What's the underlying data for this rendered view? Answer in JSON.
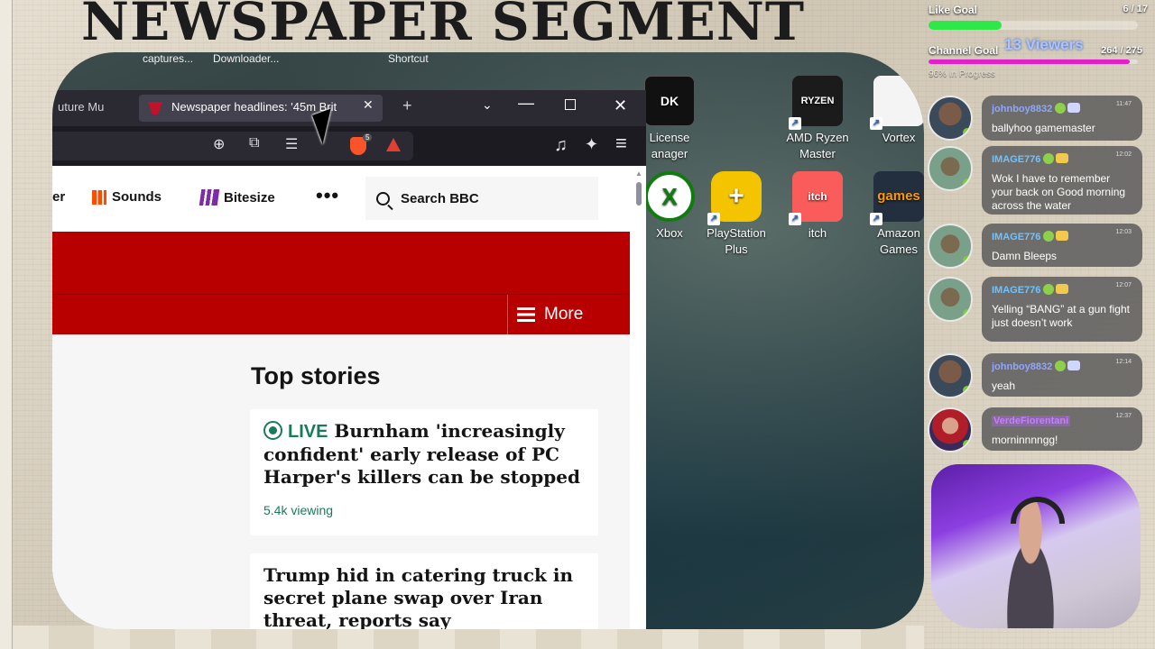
{
  "overlay": {
    "segment_title": "NEWSPAPER SEGMENT"
  },
  "desktop": {
    "top_labels": [
      "captures...",
      "Downloader...",
      "Shortcut"
    ],
    "icons": [
      {
        "label_line1": "License",
        "label_line2": "anager",
        "glyph": "DK",
        "color": "#111111"
      },
      {
        "label_line1": "AMD Ryzen",
        "label_line2": "Master",
        "glyph": "RYZEN",
        "color": "#1b1b1b"
      },
      {
        "label_line1": "Vortex",
        "label_line2": "",
        "glyph": "",
        "color": "#f4f4f4"
      },
      {
        "label_line1": "Xbox",
        "label_line2": "",
        "glyph": "X",
        "color": "#107c10"
      },
      {
        "label_line1": "PlayStation",
        "label_line2": "Plus",
        "glyph": "+",
        "color": "#f5c400"
      },
      {
        "label_line1": "itch",
        "label_line2": "",
        "glyph": "itch",
        "color": "#fa5c5c"
      },
      {
        "label_line1": "Amazon",
        "label_line2": "Games",
        "glyph": "games",
        "color": "#232f3e"
      }
    ]
  },
  "browser": {
    "prev_tab_label": "uture Mu",
    "active_tab_label": "Newspaper headlines: '45m Brit",
    "tab_close": "✕",
    "new_tab": "+",
    "tab_list": "⌄",
    "minimize": "—",
    "close": "✕",
    "toolbar": {
      "zoom": "⊕",
      "cast": "⧉",
      "reader": "☰",
      "extensions_badge": "5",
      "music": "♫",
      "sparkle": "✦",
      "menu": "≡"
    }
  },
  "bbc": {
    "nav_cut_label": "er",
    "sounds_label": "Sounds",
    "bitesize_label": "Bitesize",
    "more_dots": "•••",
    "search_label": "Search BBC",
    "more_button": "More",
    "section_title": "Top stories",
    "stories": [
      {
        "live_label": "LIVE",
        "headline": "Burnham 'increasingly confident' early release of PC Harper's killers can be stopped",
        "viewing": "5.4k viewing"
      },
      {
        "headline": "Trump hid in catering truck in secret plane swap over Iran threat, reports say"
      }
    ]
  },
  "goals": {
    "like_goal_label": "Like Goal",
    "like_goal_count": "6 / 17",
    "like_goal_fraction": 0.35,
    "like_color": "#2ee84a",
    "channel_goal_label": "Channel Goal",
    "viewers": "13 Viewers",
    "channel_goal_count": "264 / 275",
    "channel_goal_fraction": 0.96,
    "channel_color": "#e21fc8",
    "progress_note": "96% In Progress"
  },
  "chat": [
    {
      "user": "johnboy8832",
      "user_color": "#8fa6ff",
      "time": "11:47",
      "text": "ballyhoo gamemaster"
    },
    {
      "user": "IMAGE776",
      "user_color": "#6fc3ff",
      "time": "12:02",
      "text": "Wok I have to remember your back on Good morning across the water"
    },
    {
      "user": "IMAGE776",
      "user_color": "#6fc3ff",
      "time": "12:03",
      "text": "Damn Bleeps"
    },
    {
      "user": "IMAGE776",
      "user_color": "#6fc3ff",
      "time": "12:07",
      "text": "Yelling “BANG” at a gun fight just doesn’t work"
    },
    {
      "user": "johnboy8832",
      "user_color": "#8fa6ff",
      "time": "12:14",
      "text": "yeah"
    },
    {
      "user": "VerdeFiorentani",
      "user_color": "#c77dff",
      "time": "12:37",
      "text": "morninnnngg!"
    }
  ]
}
